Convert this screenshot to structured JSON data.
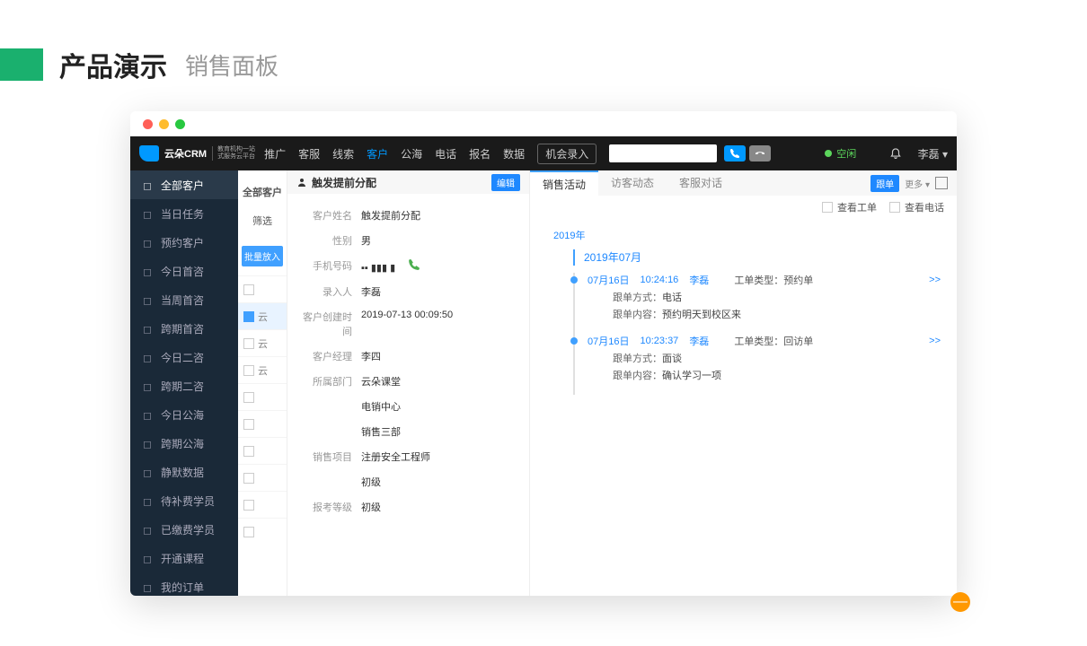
{
  "header": {
    "title": "产品演示",
    "subtitle": "销售面板"
  },
  "topbar": {
    "logo_text": "云朵CRM",
    "logo_sub1": "教育机构一站",
    "logo_sub2": "式服务云平台",
    "nav": [
      "推广",
      "客服",
      "线索",
      "客户",
      "公海",
      "电话",
      "报名",
      "数据"
    ],
    "nav_active_index": 3,
    "chance": "机会录入",
    "status": "空闲",
    "user": "李磊"
  },
  "sidebar": {
    "items": [
      {
        "label": "全部客户",
        "icon": "user"
      },
      {
        "label": "当日任务",
        "icon": "check"
      },
      {
        "label": "预约客户",
        "icon": "user"
      },
      {
        "label": "今日首咨",
        "icon": "chat"
      },
      {
        "label": "当周首咨",
        "icon": "chat"
      },
      {
        "label": "跨期首咨",
        "icon": "chat"
      },
      {
        "label": "今日二咨",
        "icon": "chat"
      },
      {
        "label": "跨期二咨",
        "icon": "chat"
      },
      {
        "label": "今日公海",
        "icon": "sea"
      },
      {
        "label": "跨期公海",
        "icon": "sea"
      },
      {
        "label": "静默数据",
        "icon": "data"
      },
      {
        "label": "待补费学员",
        "icon": "money"
      },
      {
        "label": "已缴费学员",
        "icon": "money"
      },
      {
        "label": "开通课程",
        "icon": "book"
      },
      {
        "label": "我的订单",
        "icon": "order"
      }
    ],
    "active_index": 0
  },
  "midcol": {
    "title": "全部客户",
    "filter": "筛选",
    "batch": "批量放入",
    "rows": [
      "",
      "云",
      "云",
      "云",
      "",
      "",
      "",
      "",
      "",
      ""
    ],
    "selected_index": 1
  },
  "detail": {
    "title": "触发提前分配",
    "edit": "编辑",
    "fields": [
      {
        "label": "客户姓名",
        "value": "触发提前分配"
      },
      {
        "label": "性别",
        "value": "男"
      },
      {
        "label": "手机号码",
        "value": "▪▪ ▮▮▮ ▮",
        "phone": true
      },
      {
        "label": "录入人",
        "value": "李磊"
      },
      {
        "label": "客户创建时间",
        "value": "2019-07-13 00:09:50"
      },
      {
        "label": "客户经理",
        "value": "李四"
      },
      {
        "label": "所属部门",
        "value": "云朵课堂"
      },
      {
        "label": "",
        "value": "电销中心"
      },
      {
        "label": "",
        "value": "销售三部"
      },
      {
        "label": "销售项目",
        "value": "注册安全工程师"
      },
      {
        "label": "",
        "value": "初级"
      },
      {
        "label": "报考等级",
        "value": "初级"
      }
    ]
  },
  "activity": {
    "tabs": [
      "销售活动",
      "访客动态",
      "客服对话"
    ],
    "active_tab": 0,
    "follow_btn": "跟单",
    "more_btn": "更多 ▾",
    "filters": {
      "ticket": "查看工单",
      "phone": "查看电话"
    },
    "year": "2019年",
    "month": "2019年07月",
    "entries": [
      {
        "date": "07月16日",
        "time": "10:24:16",
        "person": "李磊",
        "type_label": "工单类型：",
        "type_value": "预约单",
        "method_label": "跟单方式：",
        "method_value": "电话",
        "content_label": "跟单内容：",
        "content_value": "预约明天到校区来",
        "expand": ">>"
      },
      {
        "date": "07月16日",
        "time": "10:23:37",
        "person": "李磊",
        "type_label": "工单类型：",
        "type_value": "回访单",
        "method_label": "跟单方式：",
        "method_value": "面谈",
        "content_label": "跟单内容：",
        "content_value": "确认学习一项",
        "expand": ">>"
      }
    ]
  }
}
